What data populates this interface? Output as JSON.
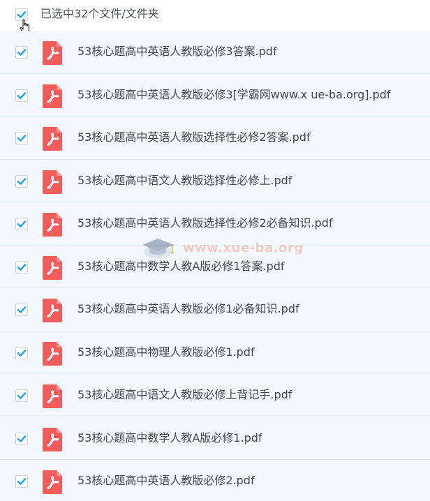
{
  "selection_bar": {
    "label": "已选中32个文件/文件夹",
    "checked": true
  },
  "files": [
    {
      "name": "53核心题高中英语人教版必修3答案.pdf",
      "checked": true,
      "icon": "pdf-icon"
    },
    {
      "name": "53核心题高中英语人教版必修3[学霸网www.x ue-ba.org].pdf",
      "checked": true,
      "icon": "pdf-icon"
    },
    {
      "name": "53核心题高中英语人教版选择性必修2答案.pdf",
      "checked": true,
      "icon": "pdf-icon"
    },
    {
      "name": "53核心题高中语文人教版选择性必修上.pdf",
      "checked": true,
      "icon": "pdf-icon"
    },
    {
      "name": "53核心题高中英语人教版选择性必修2必备知识.pdf",
      "checked": true,
      "icon": "pdf-icon"
    },
    {
      "name": "53核心题高中数学人教A版必修1答案.pdf",
      "checked": true,
      "icon": "pdf-icon"
    },
    {
      "name": "53核心题高中英语人教版必修1必备知识.pdf",
      "checked": true,
      "icon": "pdf-icon"
    },
    {
      "name": "53核心题高中物理人教版必修1.pdf",
      "checked": true,
      "icon": "pdf-icon"
    },
    {
      "name": "53核心题高中语文人教版必修上背记手.pdf",
      "checked": true,
      "icon": "pdf-icon"
    },
    {
      "name": "53核心题高中数学人教A版必修1.pdf",
      "checked": true,
      "icon": "pdf-icon"
    },
    {
      "name": "53核心题高中英语人教版必修2.pdf",
      "checked": true,
      "icon": "pdf-icon"
    }
  ],
  "watermark": {
    "text": "www.xue-ba.org"
  },
  "colors": {
    "check_accent": "#1e9fff",
    "pdf_red": "#f25c5c",
    "row_bg": "#f3f8fe"
  }
}
